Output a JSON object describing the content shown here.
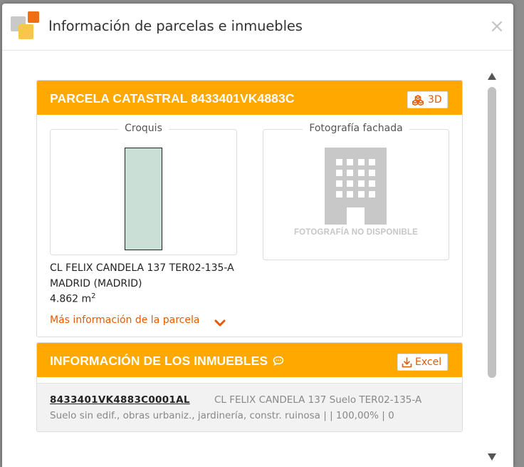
{
  "modal": {
    "title": "Información de parcelas e inmuebles",
    "close_symbol": "×",
    "icons": {
      "logo": "layers-logo-icon",
      "close": "close-icon"
    },
    "colors": {
      "accent": "#ffa900",
      "link": "#e55a00"
    }
  },
  "parcela": {
    "title": "PARCELA CATASTRAL 8433401VK4883C",
    "button_3d_label": "3D",
    "button_3d_icon": "cubes-icon",
    "croquis_legend": "Croquis",
    "foto_legend": "Fotografía fachada",
    "foto_placeholder": "FOTOGRAFÍA NO DISPONIBLE",
    "foto_icon": "building-icon",
    "address_line1": "CL FELIX CANDELA 137 TER02-135-A",
    "address_line2": "MADRID (MADRID)",
    "area_value": "4.862 m",
    "area_exponent": "2",
    "more_info_label": "Más información de la parcela",
    "more_info_icon": "chevron-down-icon"
  },
  "inmuebles": {
    "title": "INFORMACIÓN DE LOS INMUEBLES",
    "title_icon": "comment-icon",
    "excel_label": "Excel",
    "excel_icon": "download-icon",
    "items": [
      {
        "ref": "8433401VK4883C0001AL",
        "address": "CL FELIX CANDELA 137 Suelo TER02-135-A",
        "description": "Suelo sin edif., obras urbaniz., jardinería, constr. ruinosa | | 100,00% | 0"
      }
    ]
  }
}
